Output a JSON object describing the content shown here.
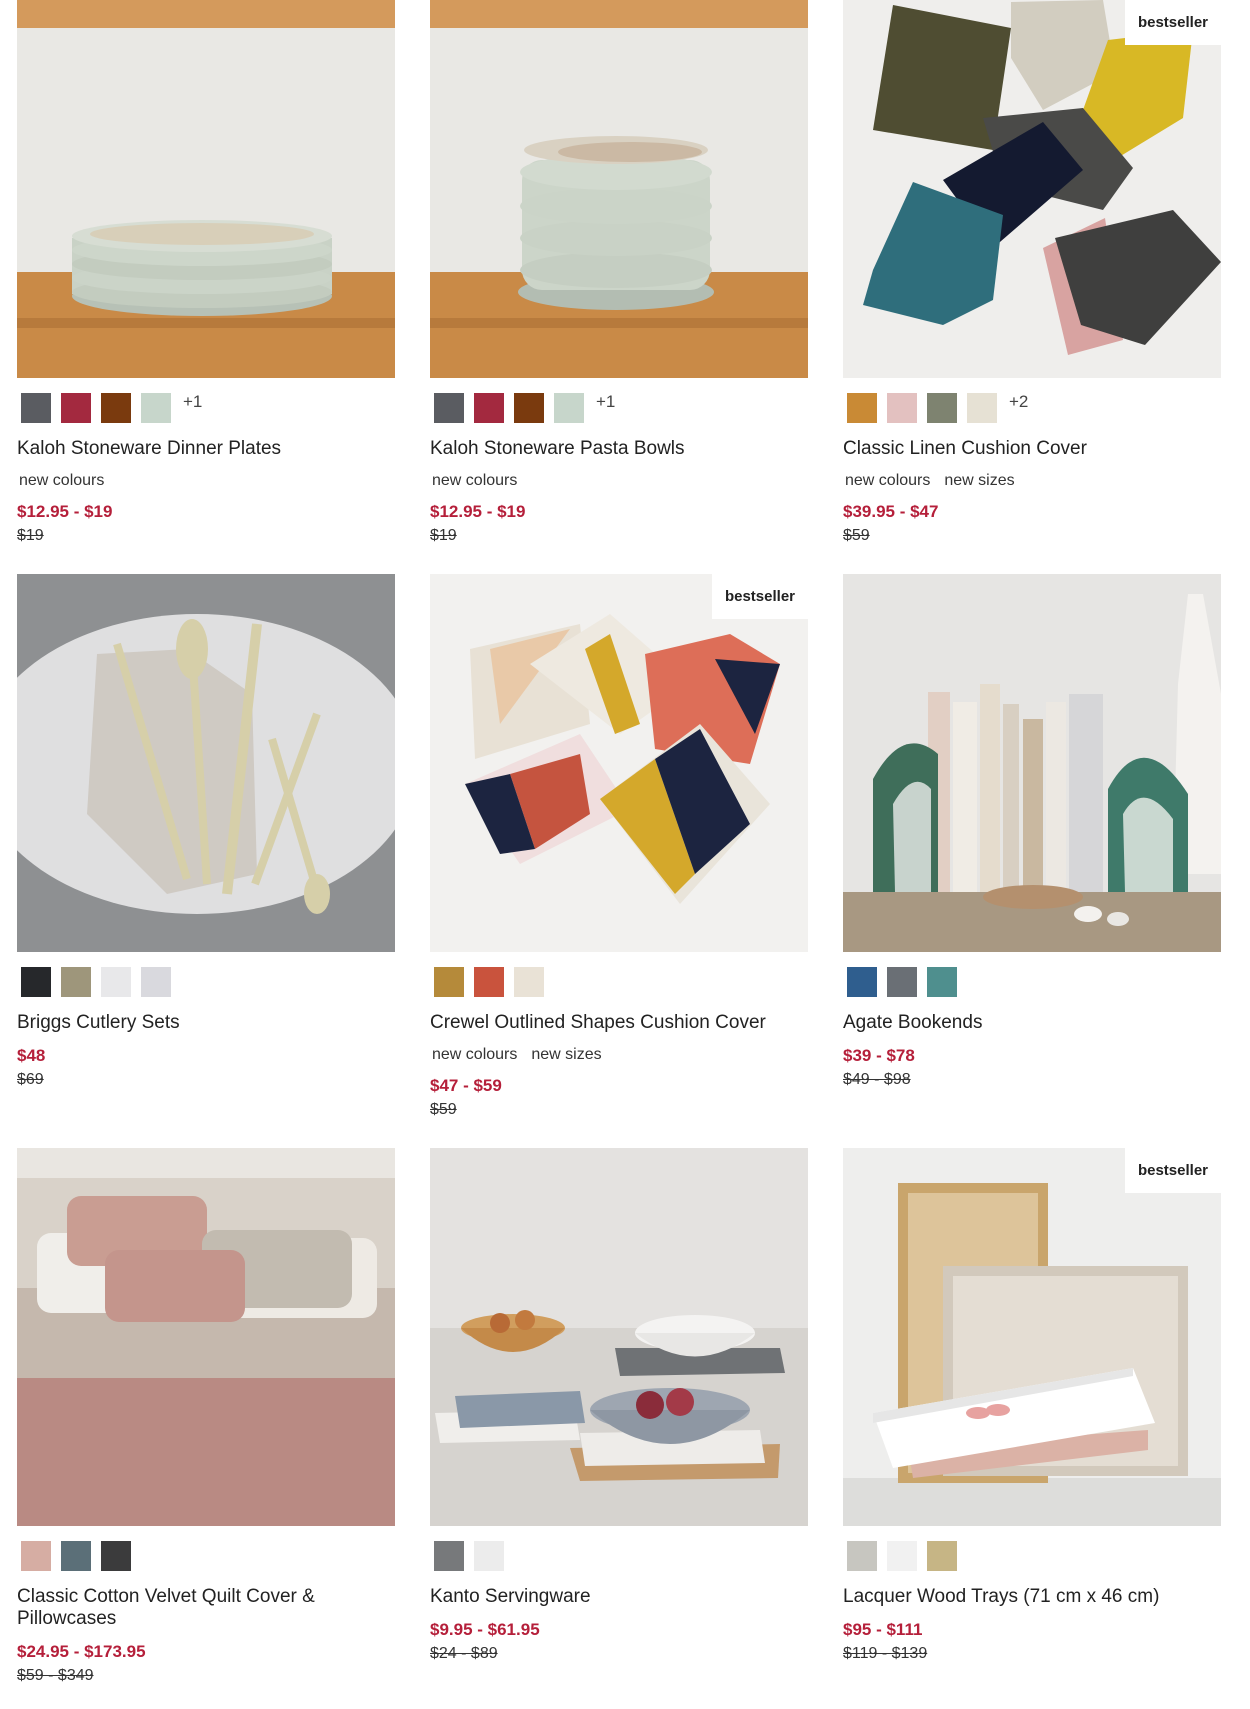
{
  "products": [
    {
      "name": "Kaloh Stoneware Dinner Plates",
      "image": "dinner-plates-image",
      "badge": null,
      "swatches": [
        "#5a5c61",
        "#a3293f",
        "#7a3a0e",
        "#c7d6cb"
      ],
      "more_swatches": "+1",
      "tags": [
        "new colours"
      ],
      "sale_price": "$12.95 - $19",
      "original_price": "$19"
    },
    {
      "name": "Kaloh Stoneware Pasta Bowls",
      "image": "pasta-bowls-image",
      "badge": null,
      "swatches": [
        "#5a5c61",
        "#a3293f",
        "#7a3a0e",
        "#c7d6cb"
      ],
      "more_swatches": "+1",
      "tags": [
        "new colours"
      ],
      "sale_price": "$12.95 - $19",
      "original_price": "$19"
    },
    {
      "name": "Classic Linen Cushion Cover",
      "image": "linen-cushions-image",
      "badge": "bestseller",
      "swatches": [
        "#c98a35",
        "#e3c1c0",
        "#7e8370",
        "#e6e1d4"
      ],
      "more_swatches": "+2",
      "tags": [
        "new colours",
        "new sizes"
      ],
      "sale_price": "$39.95 - $47",
      "original_price": "$59"
    },
    {
      "name": "Briggs Cutlery Sets",
      "image": "cutlery-image",
      "badge": null,
      "swatches": [
        "#26282b",
        "#9e967b",
        "#e8e8ea",
        "#d9d9de"
      ],
      "more_swatches": "",
      "tags": [],
      "sale_price": "$48",
      "original_price": "$69"
    },
    {
      "name": "Crewel Outlined Shapes Cushion Cover",
      "image": "crewel-cushions-image",
      "badge": "bestseller",
      "swatches": [
        "#b58a3a",
        "#c9533d",
        "#e9e2d6"
      ],
      "more_swatches": "",
      "tags": [
        "new colours",
        "new sizes"
      ],
      "sale_price": "$47 - $59",
      "original_price": "$59"
    },
    {
      "name": "Agate Bookends",
      "image": "bookends-image",
      "badge": null,
      "swatches": [
        "#2f5e8e",
        "#6a6f75",
        "#4f8f8e"
      ],
      "more_swatches": "",
      "tags": [],
      "sale_price": "$39 - $78",
      "original_price": "$49 - $98"
    },
    {
      "name": "Classic Cotton Velvet Quilt Cover & Pillowcases",
      "image": "velvet-bedding-image",
      "badge": null,
      "swatches": [
        "#d6ada3",
        "#5b6f78",
        "#3b3b3c"
      ],
      "more_swatches": "",
      "tags": [],
      "sale_price": "$24.95 - $173.95",
      "original_price": "$59 - $349"
    },
    {
      "name": "Kanto Servingware",
      "image": "servingware-image",
      "badge": null,
      "swatches": [
        "#77797b",
        "#ececec"
      ],
      "more_swatches": "",
      "tags": [],
      "sale_price": "$9.95 - $61.95",
      "original_price": "$24 - $89"
    },
    {
      "name": "Lacquer Wood Trays (71 cm x 46 cm)",
      "image": "trays-image",
      "badge": "bestseller",
      "swatches": [
        "#c7c6c0",
        "#f1f1f1",
        "#c6b585"
      ],
      "more_swatches": "",
      "tags": [],
      "sale_price": "$95 - $111",
      "original_price": "$119 - $139"
    }
  ]
}
